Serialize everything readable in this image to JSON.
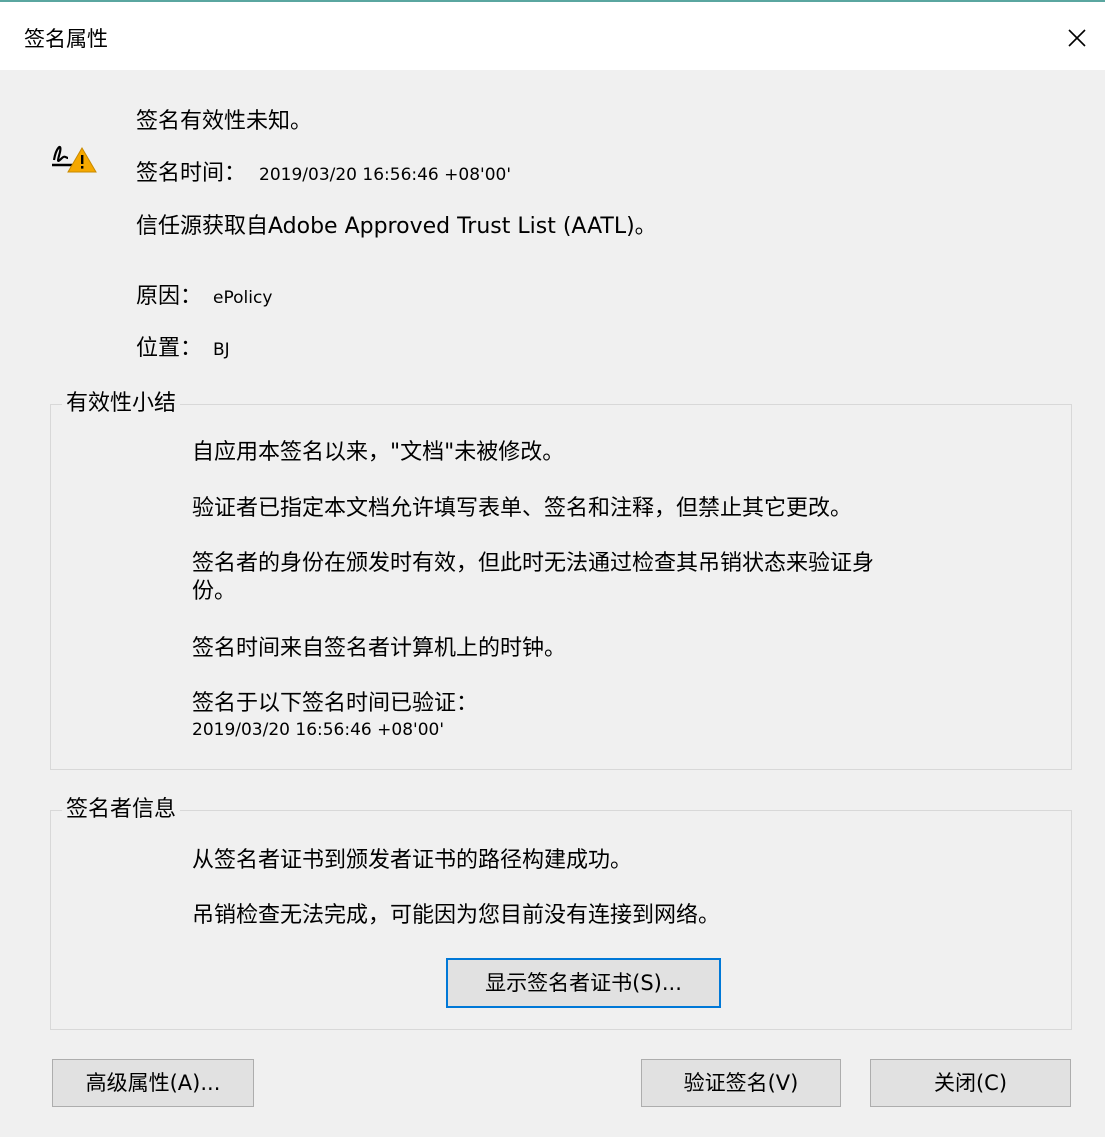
{
  "window": {
    "title": "签名属性"
  },
  "header": {
    "status": "签名有效性未知。",
    "sign_time_label": "签名时间：",
    "sign_time_value": "2019/03/20 16:56:46 +08'00'",
    "trust_source": "信任源获取自Adobe Approved Trust List (AATL)。",
    "reason_label": "原因：",
    "reason_value": "ePolicy",
    "location_label": "位置：",
    "location_value": "BJ"
  },
  "validity_summary": {
    "legend": "有效性小结",
    "line1": "自应用本签名以来，\"文档\"未被修改。",
    "line2": "验证者已指定本文档允许填写表单、签名和注释，但禁止其它更改。",
    "line3a": "签名者的身份在颁发时有效，但此时无法通过检查其吊销状态来验证身",
    "line3b": "份。",
    "line4": "签名时间来自签名者计算机上的时钟。",
    "line5": "签名于以下签名时间已验证：",
    "line5_time": "2019/03/20 16:56:46 +08'00'"
  },
  "signer_info": {
    "legend": "签名者信息",
    "line1": "从签名者证书到颁发者证书的路径构建成功。",
    "line2": "吊销检查无法完成，可能因为您目前没有连接到网络。",
    "show_cert_button": "显示签名者证书(S)..."
  },
  "footer": {
    "advanced_button": "高级属性(A)...",
    "validate_button": "验证签名(V)",
    "close_button": "关闭(C)"
  },
  "icons": {
    "signature_status_icon": "signature-warning-icon",
    "close_icon": "close-icon"
  },
  "colors": {
    "focus_border": "#0078d7",
    "warning": "#f5a800",
    "title_accent": "#5aa6a0"
  }
}
